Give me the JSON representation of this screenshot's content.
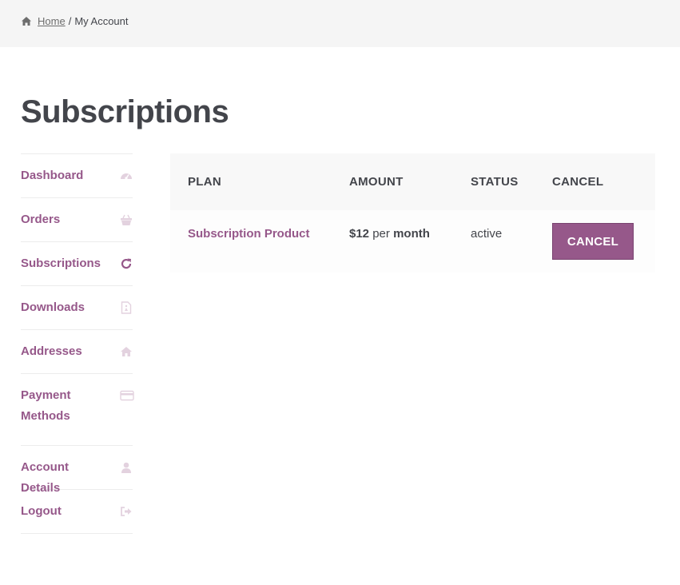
{
  "breadcrumb": {
    "home": "Home",
    "separator": "/",
    "current": "My Account"
  },
  "page": {
    "title": "Subscriptions"
  },
  "sidebar": {
    "items": [
      {
        "label": "Dashboard",
        "icon": "dashboard-icon"
      },
      {
        "label": "Orders",
        "icon": "basket-icon"
      },
      {
        "label": "Subscriptions",
        "icon": "refresh-icon"
      },
      {
        "label": "Downloads",
        "icon": "file-icon"
      },
      {
        "label": "Addresses",
        "icon": "home-icon"
      },
      {
        "label": "Payment Methods",
        "icon": "credit-card-icon"
      },
      {
        "label": "Account Details",
        "icon": "user-icon"
      },
      {
        "label": "Logout",
        "icon": "sign-out-icon"
      }
    ]
  },
  "table": {
    "headers": [
      "PLAN",
      "AMOUNT",
      "STATUS",
      "CANCEL"
    ],
    "rows": [
      {
        "plan": "Subscription Product",
        "amount_value": "$12",
        "amount_per": "per",
        "amount_period": "month",
        "status": "active",
        "cancel_label": "CANCEL"
      }
    ]
  },
  "colors": {
    "accent": "#96588a",
    "text": "#43454b",
    "icon_light": "#e3d2df"
  }
}
